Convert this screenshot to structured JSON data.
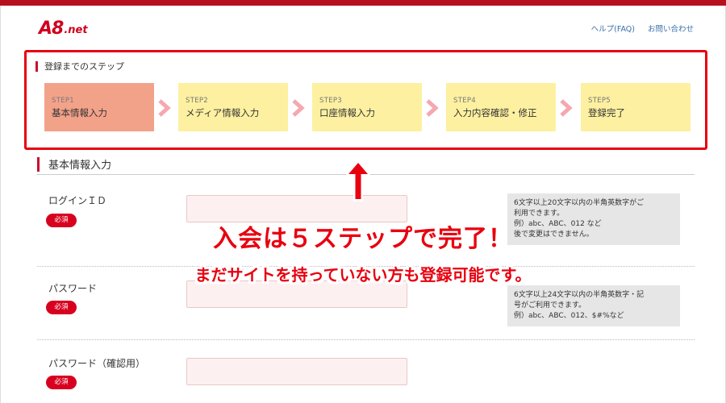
{
  "brand": {
    "logo_main": "A8",
    "logo_suffix": ".net"
  },
  "header": {
    "links": [
      "ヘルプ(FAQ)",
      "お問い合わせ"
    ]
  },
  "steps": {
    "title": "登録までのステップ",
    "items": [
      {
        "num": "STEP1",
        "label": "基本情報入力",
        "active": true
      },
      {
        "num": "STEP2",
        "label": "メディア情報入力",
        "active": false
      },
      {
        "num": "STEP3",
        "label": "口座情報入力",
        "active": false
      },
      {
        "num": "STEP4",
        "label": "入力内容確認・修正",
        "active": false
      },
      {
        "num": "STEP5",
        "label": "登録完了",
        "active": false
      }
    ]
  },
  "form": {
    "section_title": "基本情報入力",
    "required_label": "必須",
    "fields": [
      {
        "label": "ログインＩＤ",
        "help": [
          "6文字以上20文字以内の半角英数字がご",
          "利用できます。",
          "例）abc、ABC、012 など",
          "後で変更はできません。"
        ]
      },
      {
        "label": "パスワード",
        "help": [
          "6文字以上24文字以内の半角英数字・記",
          "号がご利用できます。",
          "例）abc、ABC、012、$#%など"
        ]
      },
      {
        "label": "パスワード（確認用）"
      }
    ]
  },
  "overlay": {
    "headline": "入会は５ステップで完了！",
    "subline": "まだサイトを持っていない方も登録可能です。"
  },
  "colors": {
    "brand_red": "#d0001c",
    "step_active": "#f3a28a",
    "step_inactive": "#fdf0a0",
    "highlight_red": "#e8000f"
  }
}
